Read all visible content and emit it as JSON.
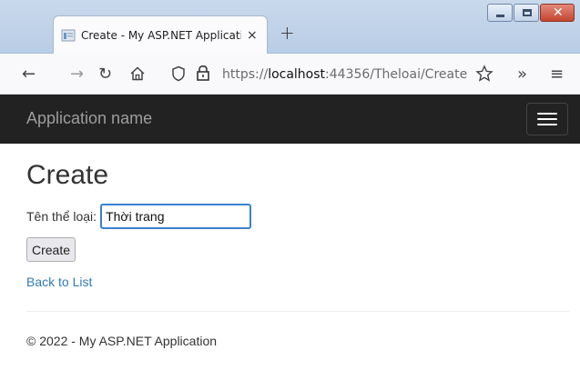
{
  "browser": {
    "tab_title": "Create - My ASP.NET Applicatio",
    "tab_close": "×",
    "new_tab": "+",
    "url_prefix": "https://",
    "url_host": "localhost",
    "url_rest": ":44356/Theloai/Create",
    "icons": [
      "back-icon",
      "forward-icon",
      "reload-icon",
      "home-icon",
      "shield-icon",
      "lock-icon",
      "star-icon",
      "overflow-icon",
      "menu-icon"
    ]
  },
  "app": {
    "brand": "Application name"
  },
  "page": {
    "title": "Create",
    "field_label": "Tên thể loại:",
    "field_value": "Thời trang",
    "submit_label": "Create",
    "back_link": "Back to List",
    "footer": "© 2022 - My ASP.NET Application"
  },
  "colors": {
    "header_bg": "#222222",
    "link": "#337ab7",
    "input_focus": "#3b7fd0"
  }
}
